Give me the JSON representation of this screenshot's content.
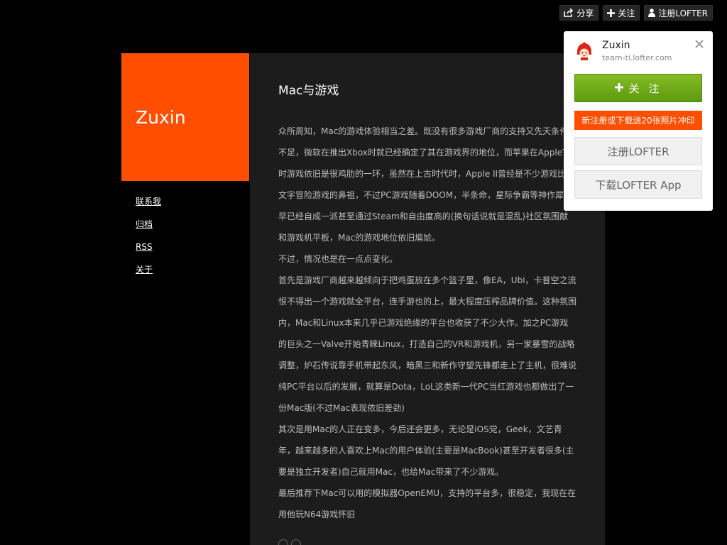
{
  "toolbar": {
    "share_label": "分享",
    "follow_label": "关注",
    "register_label": "注册LOFTER"
  },
  "brand": {
    "title": "Zuxin"
  },
  "nav": {
    "items": [
      "联系我",
      "归档",
      "RSS",
      "关于"
    ]
  },
  "post": {
    "title": "Mac与游戏",
    "paragraphs": [
      "众所周知，Mac的游戏体验相当之差。既没有很多游戏厂商的支持又先天条件不足，微软在推出Xbox时就已经确定了其在游戏界的地位，而苹果在AppleTV时游戏依旧是很鸡肋的一环，虽然在上古时代时，Apple II曾经是不少游戏比如文字冒险游戏的鼻祖，不过PC游戏随着DOOM，半条命，星际争霸等神作犀利早已经自成一派甚至通过Steam和自由度高的(换句话说就是混乱)社区氛围献和游戏机平板，Mac的游戏地位依旧尴尬。",
      "不过，情况也是在一点点变化。",
      "首先是游戏厂商越来越倾向于把鸡蛋放在多个篮子里，像EA，Ubi，卡普空之流恨不得出一个游戏就全平台，连手游也的上，最大程度压榨品牌价值。这种氛围内，Mac和Linux本来几乎已游戏绝缘的平台也收获了不少大作。加之PC游戏的巨头之一Valve开始青睐Linux，打造自己的VR和游戏机，另一家暴雪的战略调整，炉石传说靠手机带起东风，暗黑三和新作守望先锋都走上了主机，很难说纯PC平台以后的发展，就算是Dota，LoL这类新一代PC当红游戏也都做出了一份Mac版(不过Mac表现依旧差劲)",
      "其次是用Mac的人正在变多，今后还会更多，无论是iOS党，Geek，文艺青年，越来越多的人喜欢上Mac的用户体验(主要是MacBook)甚至开发者很多(主要是独立开发者)自己就用Mac，也给Mac带来了不少游戏。",
      "最后推荐下Mac可以用的模拟器OpenEMU，支持的平台多，很稳定，我现在在用他玩N64游戏怀旧"
    ]
  },
  "panel": {
    "name": "Zuxin",
    "url": "team-ti.lofter.com",
    "follow_label": "关 注",
    "promo": "新注册或下载送20张照片冲印",
    "register_label": "注册LOFTER",
    "download_label": "下载LOFTER App"
  },
  "colors": {
    "brand": "#ff4e00",
    "follow_green": "#6aa81a",
    "background": "#000000"
  },
  "icons": {
    "share": "share-icon",
    "follow": "plus-icon",
    "register": "user-icon",
    "close": "close-icon"
  }
}
